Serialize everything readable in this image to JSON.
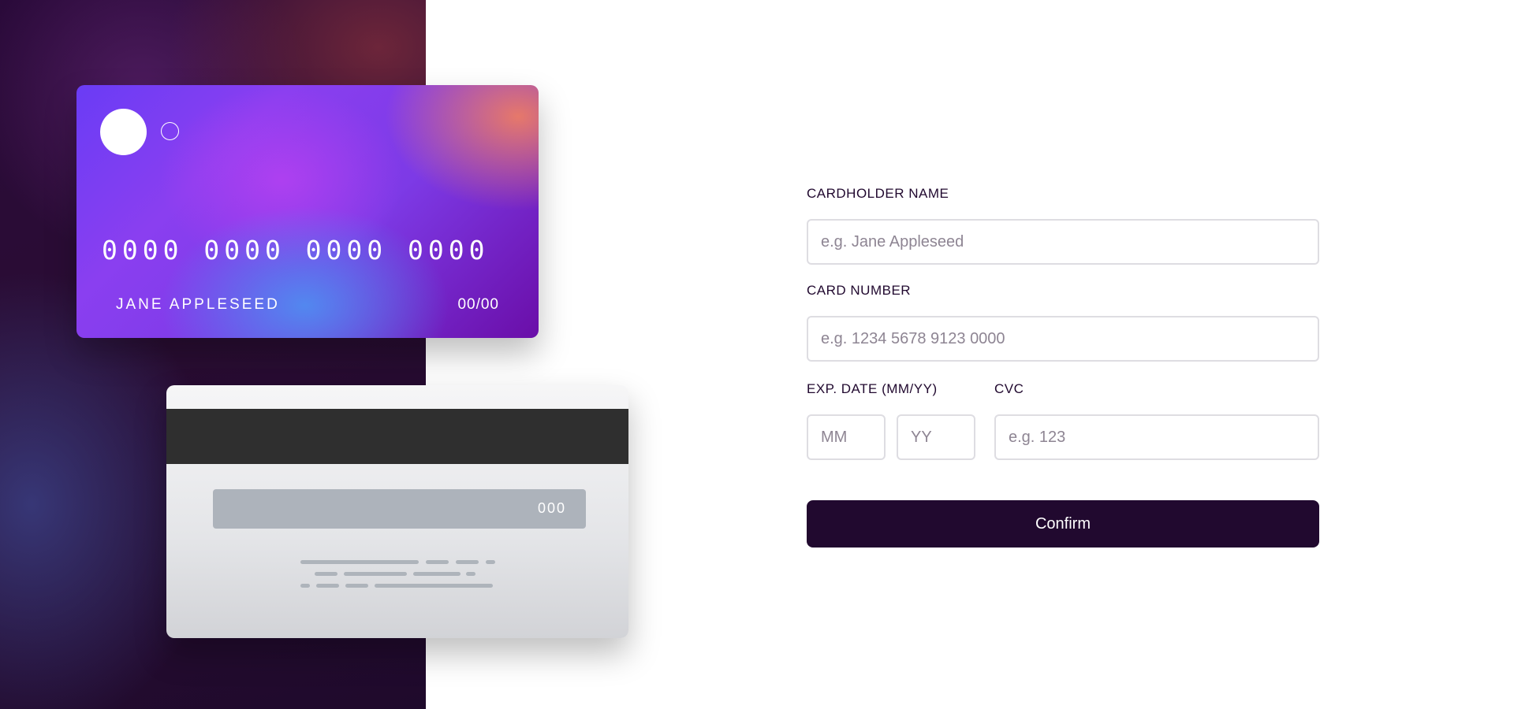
{
  "card_front": {
    "number": "0000 0000 0000 0000",
    "name": "JANE APPLESEED",
    "expiry": "00/00"
  },
  "card_back": {
    "cvc": "000"
  },
  "form": {
    "cardholder_label": "CARDHOLDER NAME",
    "cardholder_placeholder": "e.g. Jane Appleseed",
    "card_number_label": "CARD NUMBER",
    "card_number_placeholder": "e.g. 1234 5678 9123 0000",
    "exp_label": "EXP. DATE (MM/YY)",
    "month_placeholder": "MM",
    "year_placeholder": "YY",
    "cvc_label": "CVC",
    "cvc_placeholder": "e.g. 123",
    "confirm_label": "Confirm"
  },
  "colors": {
    "primary_dark": "#21092f",
    "input_border": "#dedde2",
    "placeholder": "#8e8593"
  }
}
